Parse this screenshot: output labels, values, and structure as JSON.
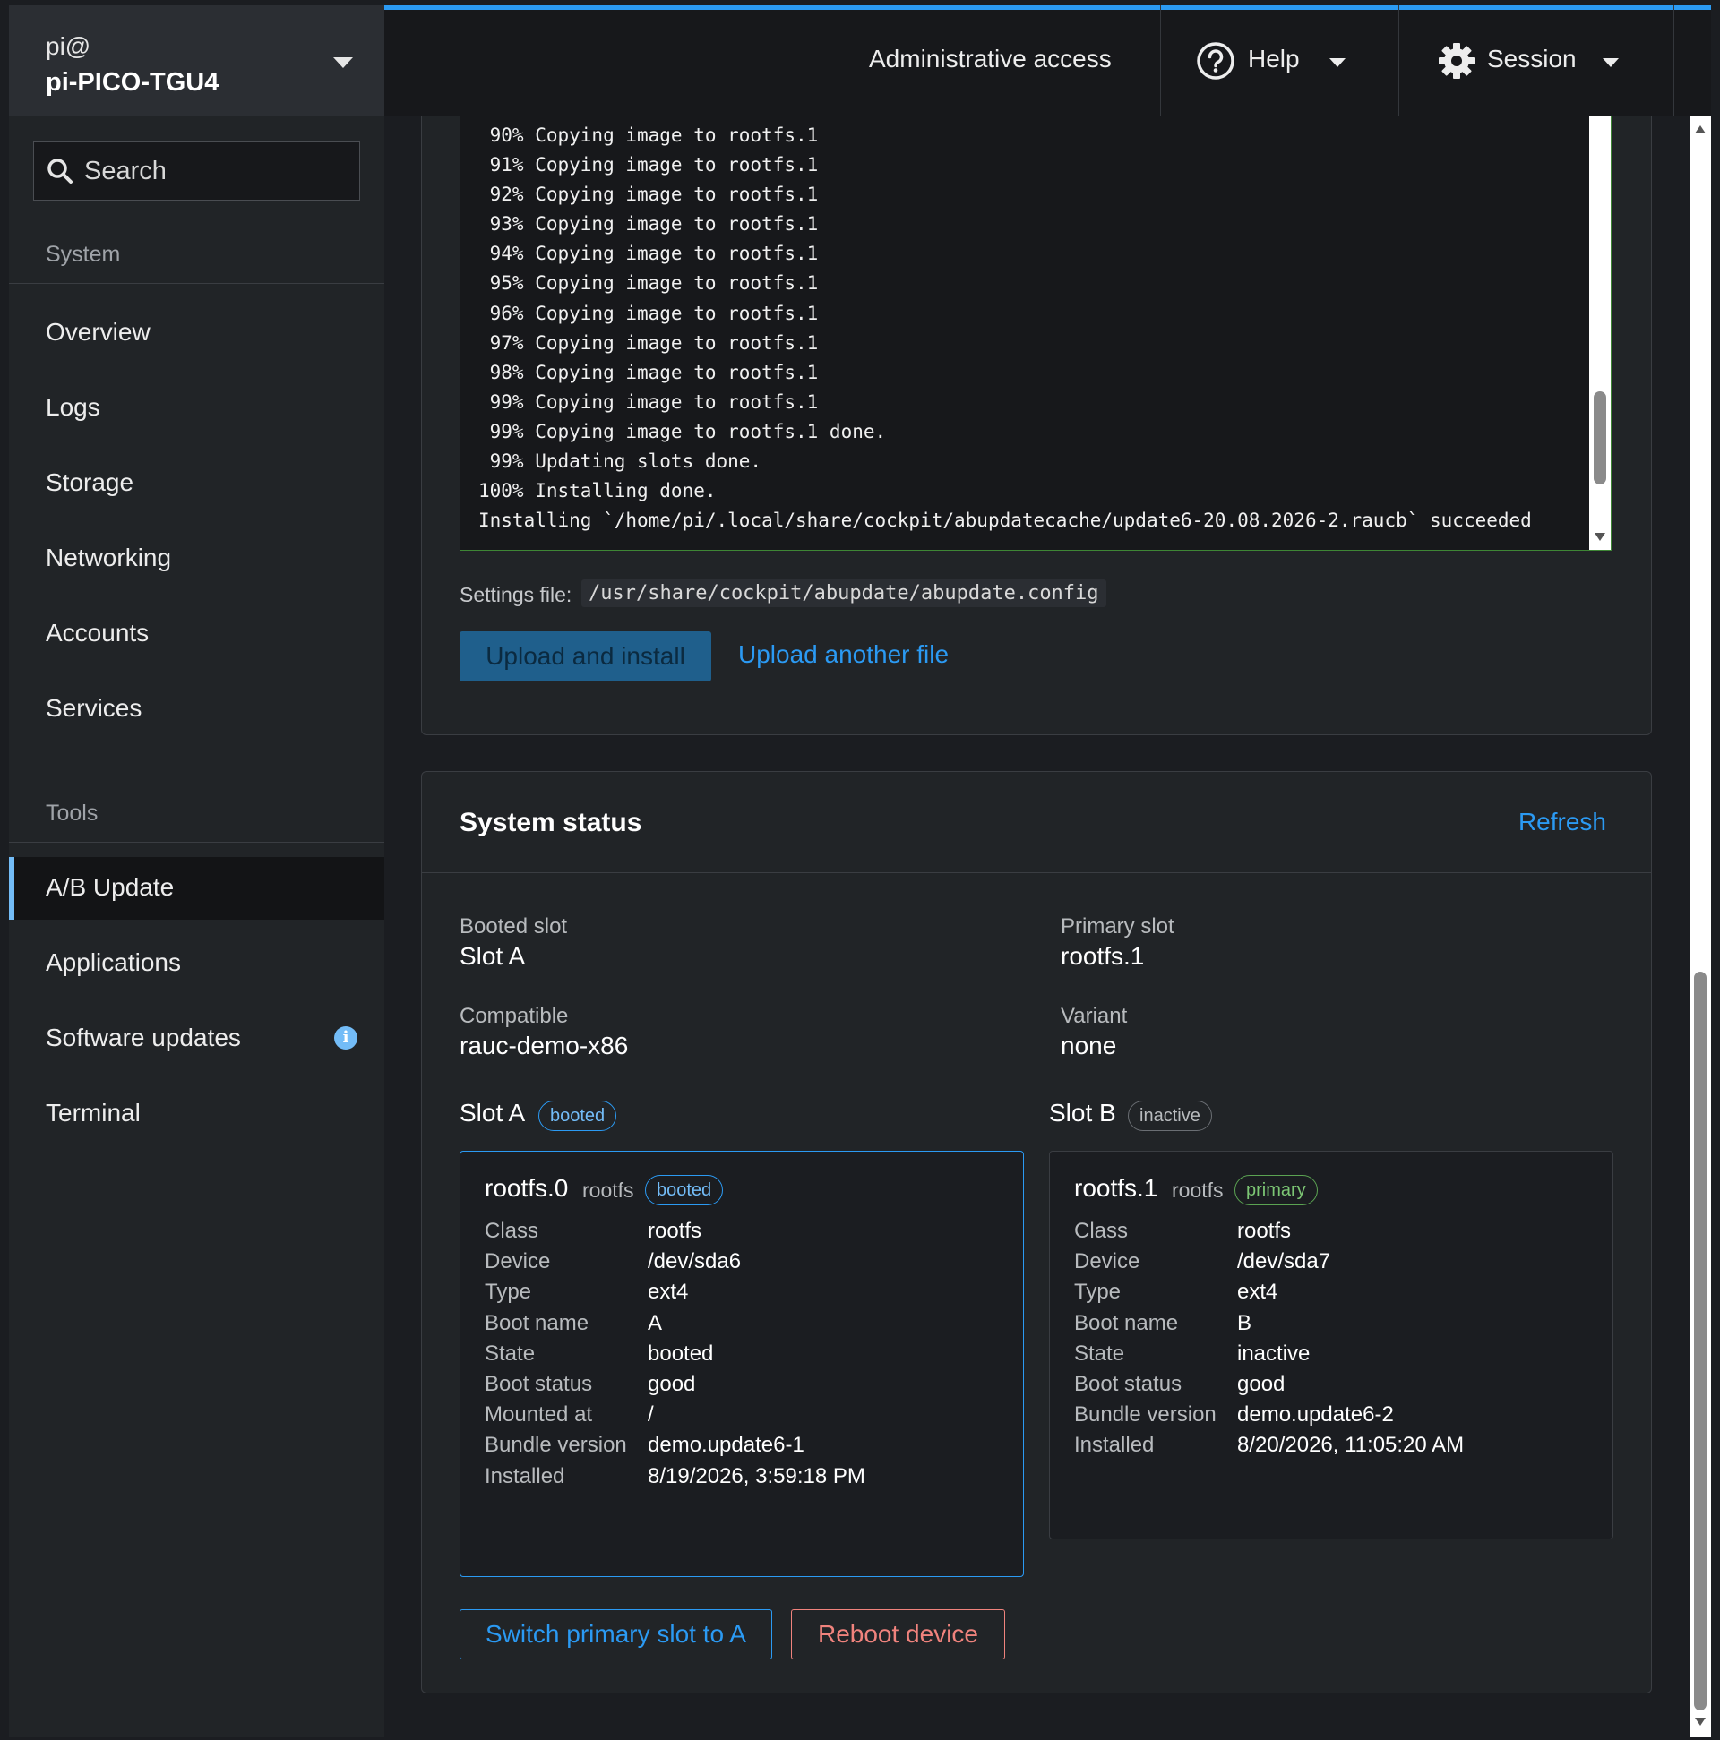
{
  "host": {
    "user": "pi@",
    "name": "pi-PICO-TGU4"
  },
  "search": {
    "placeholder": "Search"
  },
  "nav": {
    "system_section": "System",
    "system_items": [
      "Overview",
      "Logs",
      "Storage",
      "Networking",
      "Accounts",
      "Services"
    ],
    "tools_section": "Tools",
    "tools_items": [
      "A/B Update",
      "Applications",
      "Software updates",
      "Terminal"
    ],
    "active_item": "A/B Update",
    "software_updates_badge": "i"
  },
  "topbar": {
    "admin_access": "Administrative access",
    "help": "Help",
    "session": "Session"
  },
  "install": {
    "log": [
      " 90% Copying image to rootfs.1",
      " 91% Copying image to rootfs.1",
      " 92% Copying image to rootfs.1",
      " 93% Copying image to rootfs.1",
      " 94% Copying image to rootfs.1",
      " 95% Copying image to rootfs.1",
      " 96% Copying image to rootfs.1",
      " 97% Copying image to rootfs.1",
      " 98% Copying image to rootfs.1",
      " 99% Copying image to rootfs.1",
      " 99% Copying image to rootfs.1 done.",
      " 99% Updating slots done.",
      "100% Installing done.",
      "Installing `/home/pi/.local/share/cockpit/abupdatecache/update6-20.08.2026-2.raucb` succeeded"
    ],
    "settings_label": "Settings file:",
    "settings_path": "/usr/share/cockpit/abupdate/abupdate.config",
    "upload_install": "Upload and install",
    "upload_another": "Upload another file"
  },
  "status": {
    "title": "System status",
    "refresh": "Refresh",
    "booted_slot_label": "Booted slot",
    "booted_slot_value": "Slot A",
    "primary_slot_label": "Primary slot",
    "primary_slot_value": "rootfs.1",
    "compatible_label": "Compatible",
    "compatible_value": "rauc-demo-x86",
    "variant_label": "Variant",
    "variant_value": "none",
    "slot_a": {
      "title": "Slot A",
      "pill": "booted",
      "name": "rootfs.0",
      "class_tag": "rootfs",
      "name_pill": "booted",
      "rows": [
        {
          "label": "Class",
          "value": "rootfs"
        },
        {
          "label": "Device",
          "value": "/dev/sda6"
        },
        {
          "label": "Type",
          "value": "ext4"
        },
        {
          "label": "Boot name",
          "value": "A"
        },
        {
          "label": "State",
          "value": "booted"
        },
        {
          "label": "Boot status",
          "value": "good"
        },
        {
          "label": "Mounted at",
          "value": "/"
        },
        {
          "label": "Bundle version",
          "value": "demo.update6-1"
        },
        {
          "label": "Installed",
          "value": "8/19/2026, 3:59:18 PM"
        }
      ]
    },
    "slot_b": {
      "title": "Slot B",
      "pill": "inactive",
      "name": "rootfs.1",
      "class_tag": "rootfs",
      "name_pill": "primary",
      "rows": [
        {
          "label": "Class",
          "value": "rootfs"
        },
        {
          "label": "Device",
          "value": "/dev/sda7"
        },
        {
          "label": "Type",
          "value": "ext4"
        },
        {
          "label": "Boot name",
          "value": "B"
        },
        {
          "label": "State",
          "value": "inactive"
        },
        {
          "label": "Boot status",
          "value": "good"
        },
        {
          "label": "Bundle version",
          "value": "demo.update6-2"
        },
        {
          "label": "Installed",
          "value": "8/20/2026, 11:05:20 AM"
        }
      ]
    },
    "switch_primary": "Switch primary slot to A",
    "reboot": "Reboot device"
  },
  "colors": {
    "accent": "#2b9af3",
    "danger": "#f0837d",
    "success": "#7cc674",
    "log_border": "#3e8635"
  }
}
